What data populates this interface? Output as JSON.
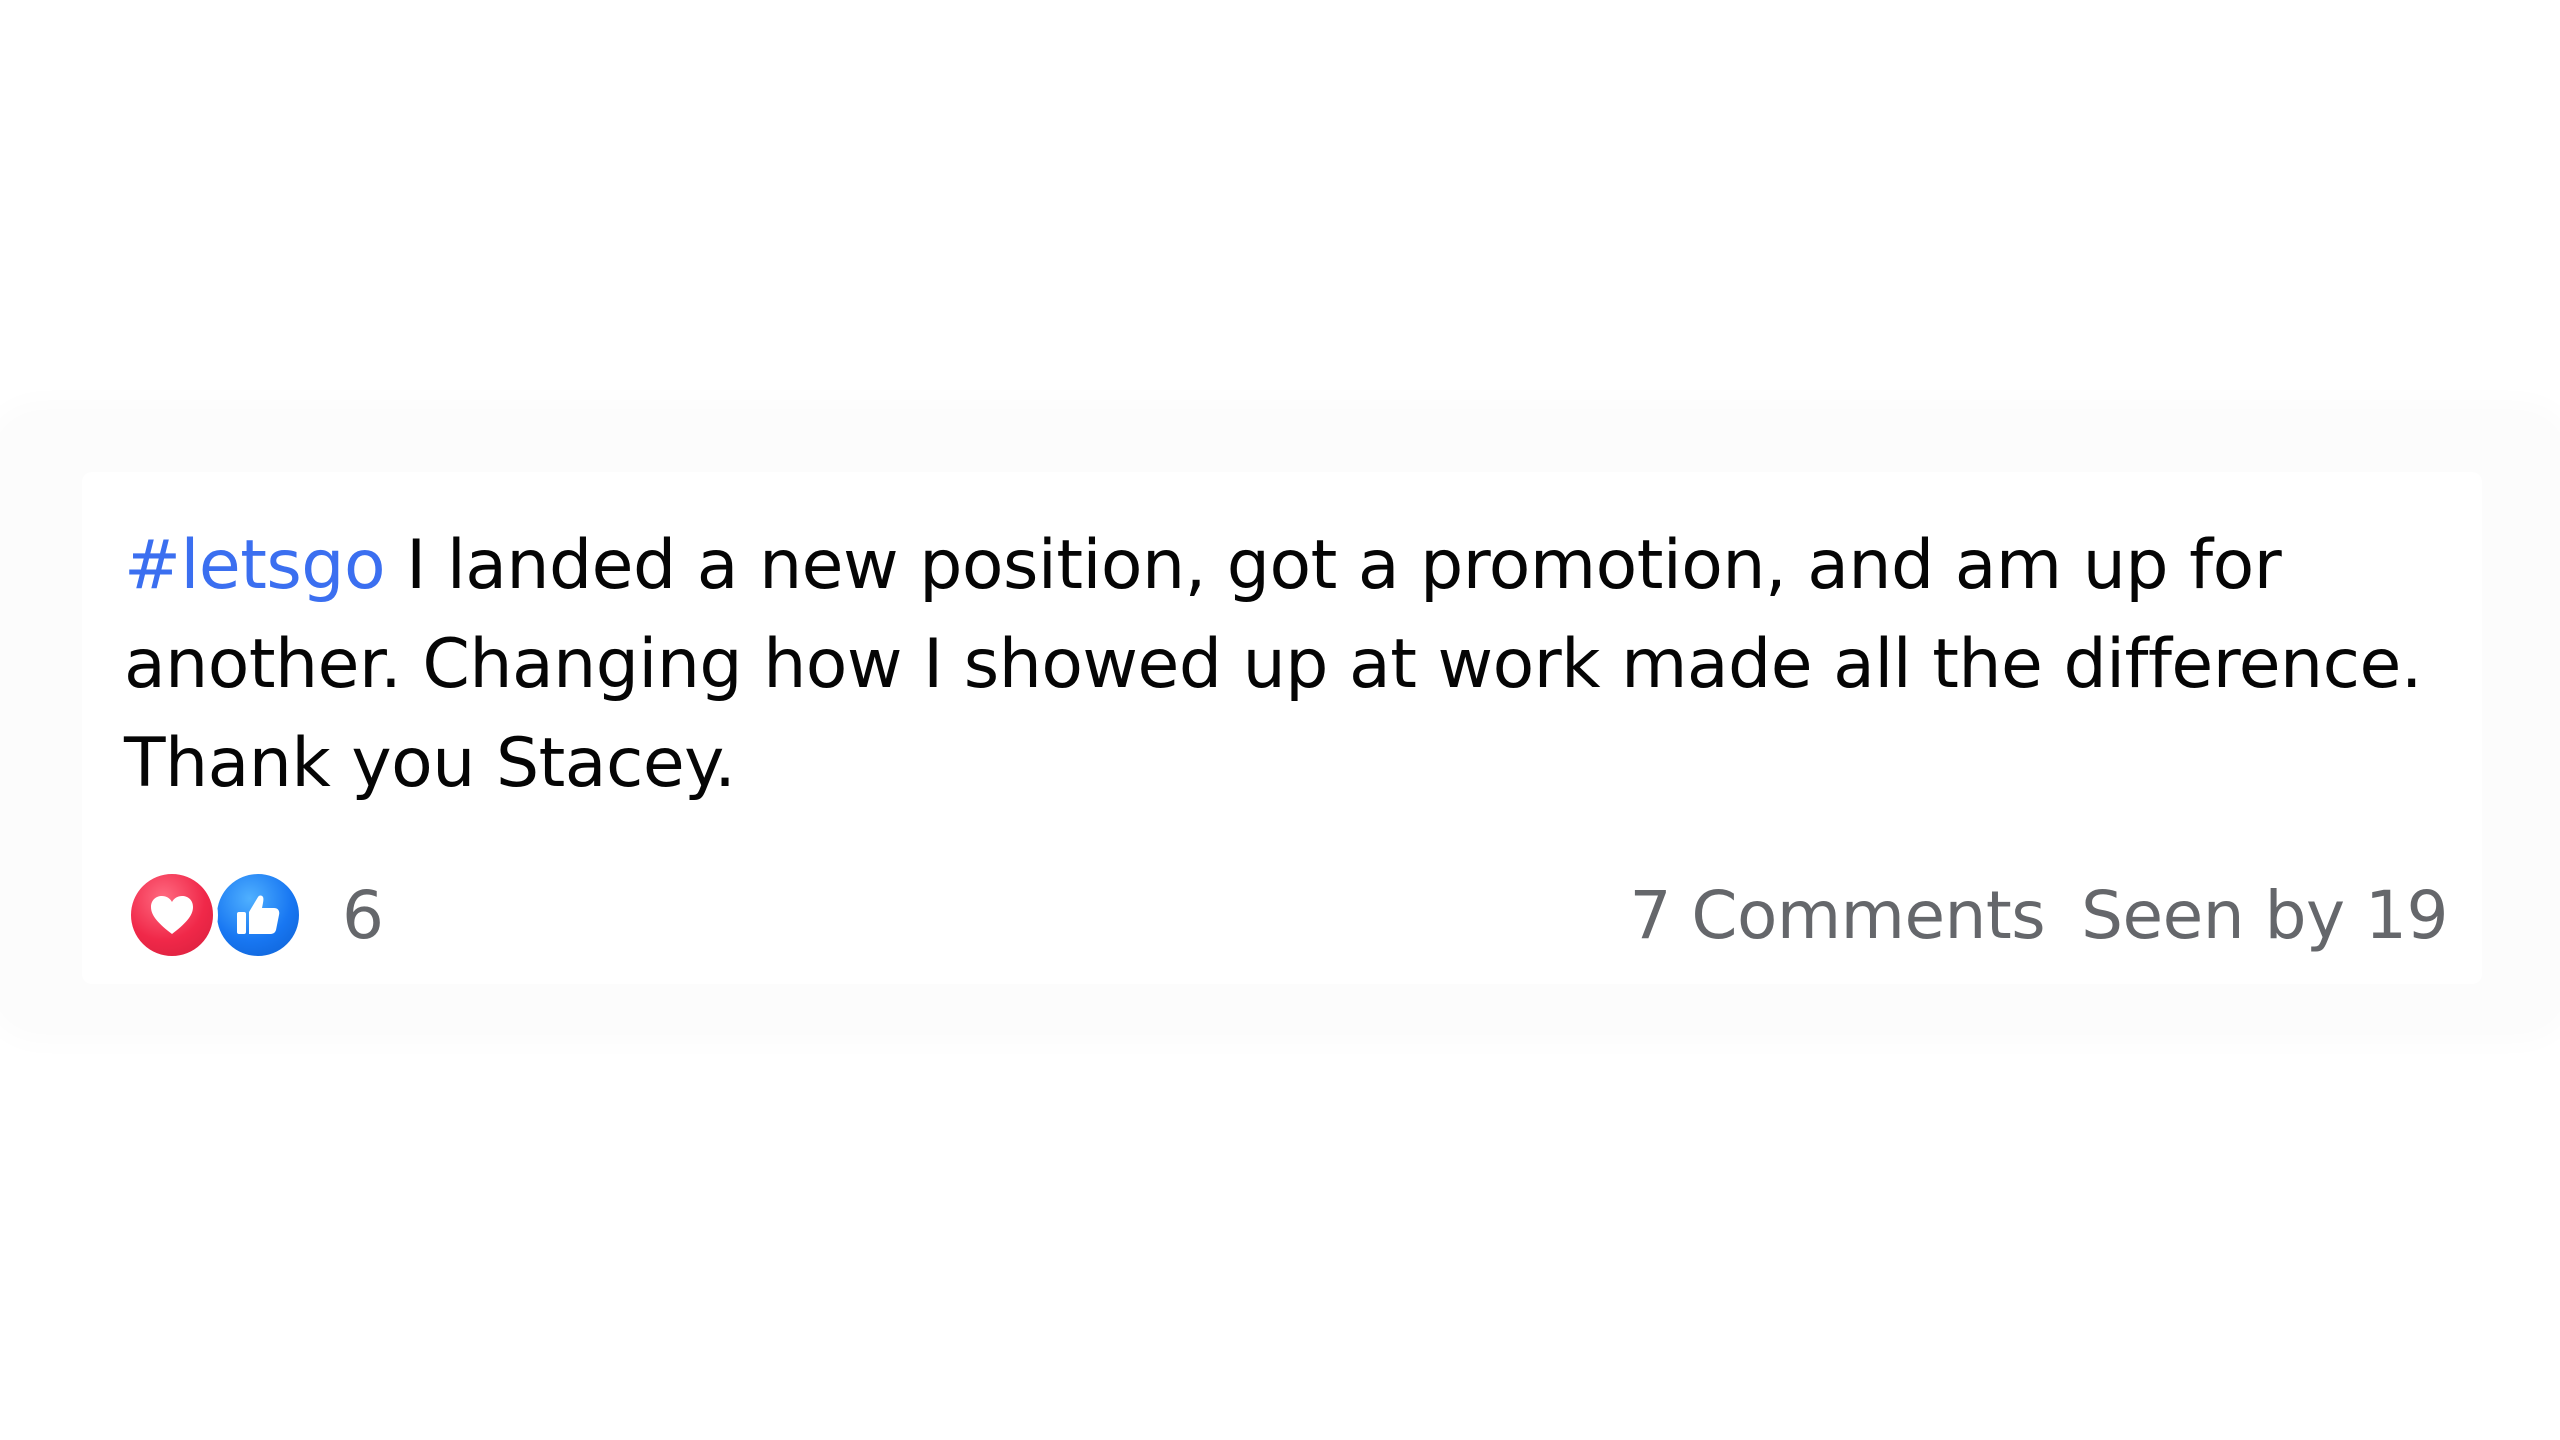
{
  "post": {
    "hashtag": "#letsgo",
    "body_line1": " I landed a new position, got a promotion, and am up for",
    "body_line2": "another. Changing how I showed up at work made all the difference.",
    "body_line3": "Thank you Stacey."
  },
  "reactions": {
    "icons": [
      "heart-icon",
      "like-icon"
    ],
    "count": "6"
  },
  "meta": {
    "comments": "7 Comments",
    "seen": "Seen by 19"
  },
  "colors": {
    "hashtag": "#3b6ff0",
    "text": "#050505",
    "muted": "#65676b",
    "heart": "#f02849",
    "like": "#1877f2"
  }
}
